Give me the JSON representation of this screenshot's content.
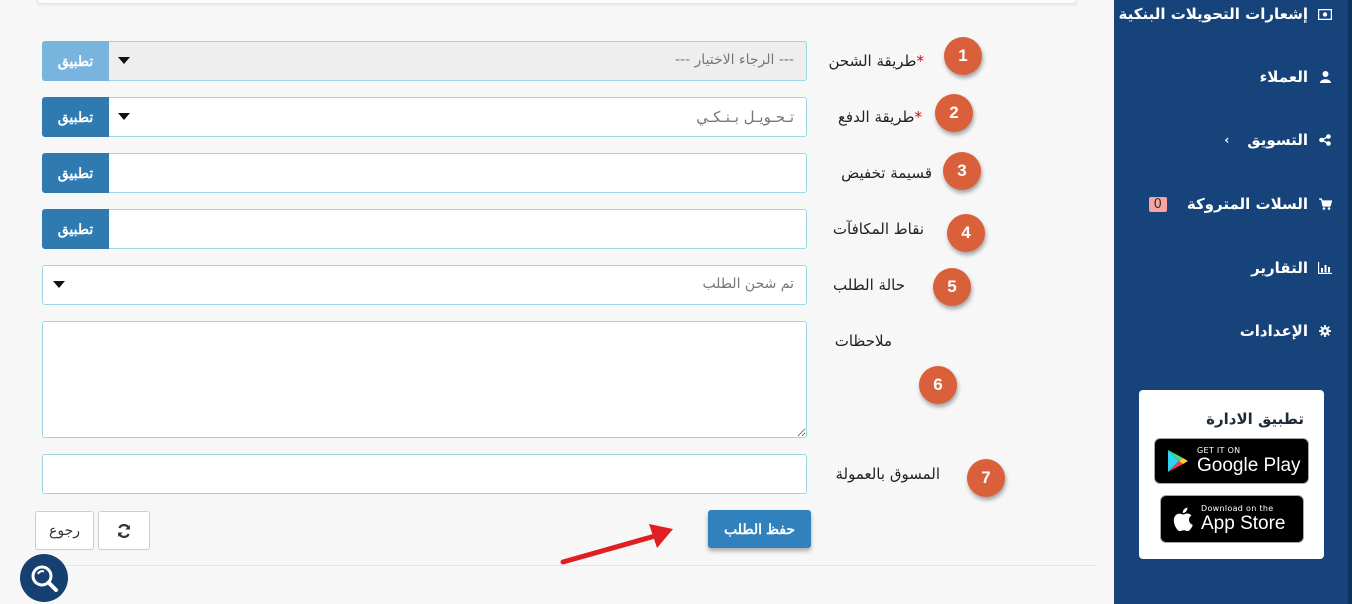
{
  "sidebar": {
    "items": [
      {
        "label": "إشعارات التحويلات البنكية",
        "icon": "money-icon"
      },
      {
        "label": "العملاء",
        "icon": "user-icon"
      },
      {
        "label": "التسويق",
        "icon": "share-icon"
      },
      {
        "label": "السلات المتروكة",
        "icon": "cart-icon",
        "badge": "0"
      },
      {
        "label": "التقارير",
        "icon": "bar-chart-icon"
      },
      {
        "label": "الإعدادات",
        "icon": "gear-icon"
      }
    ],
    "app_card": {
      "title": "تطبيق الادارة",
      "google_play": {
        "small": "GET IT ON",
        "big": "Google Play"
      },
      "app_store": {
        "small": "Download on the",
        "big": "App Store"
      }
    }
  },
  "form": {
    "shipping": {
      "num": "1",
      "label": "طريقة الشحن",
      "required": "*",
      "value": "--- الرجاء الاختيار ---",
      "apply": "تطبيق"
    },
    "payment": {
      "num": "2",
      "label": "طريقة الدفع",
      "required": "*",
      "value": "تـحـويـل بـنـكـي",
      "apply": "تطبيق"
    },
    "coupon": {
      "num": "3",
      "label": "قسيمة تخفيض",
      "apply": "تطبيق"
    },
    "reward": {
      "num": "4",
      "label": "نقاط المكافآت",
      "apply": "تطبيق"
    },
    "status": {
      "num": "5",
      "label": "حالة الطلب",
      "value": "تم شحن الطلب"
    },
    "notes": {
      "num": "6",
      "label": "ملاحظات"
    },
    "affiliate": {
      "num": "7",
      "label": "المسوق بالعمولة"
    }
  },
  "actions": {
    "save": "حفظ الطلب",
    "back": "رجوع",
    "refresh_icon": "refresh-icon"
  },
  "colors": {
    "sidebar_bg": "#16437a",
    "step_circle": "#d9603b",
    "primary_button": "#3181bd",
    "arrow": "#e02020"
  }
}
